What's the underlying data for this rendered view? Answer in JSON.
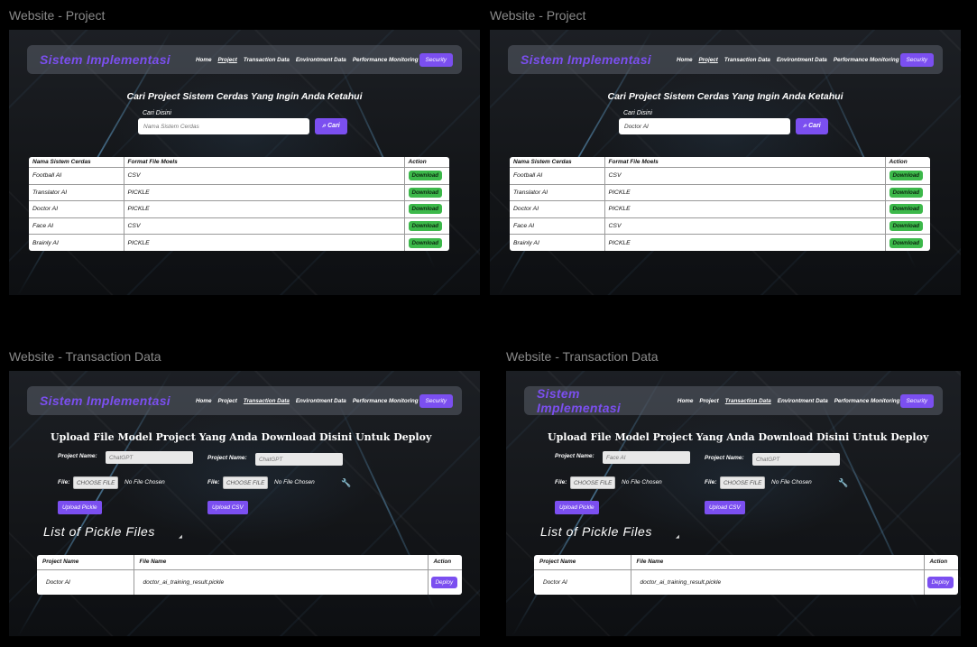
{
  "frame_labels": {
    "project": "Website - Project",
    "transaction": "Website - Transaction Data"
  },
  "navbar": {
    "brand": "Sistem Implementasi",
    "links": [
      "Home",
      "Project",
      "Transaction Data",
      "Environtment Data",
      "Performance Monitoring"
    ],
    "security_button": "Security"
  },
  "project_page": {
    "heading": "Cari Project Sistem Cerdas Yang Ingin Anda Ketahui",
    "search_label": "Cari Disini",
    "search_placeholder": "Nama Sistem Cerdas",
    "search_button": "Cari",
    "columns": [
      "Nama Sistem Cerdas",
      "Format File Moels",
      "Action"
    ],
    "rows": [
      {
        "name": "Football AI",
        "format": "CSV",
        "action": "Download"
      },
      {
        "name": "Translator AI",
        "format": "PICKLE",
        "action": "Download"
      },
      {
        "name": "Doctor AI",
        "format": "PICKLE",
        "action": "Download"
      },
      {
        "name": "Face AI",
        "format": "CSV",
        "action": "Download"
      },
      {
        "name": "Brainly AI",
        "format": "PICKLE",
        "action": "Download"
      }
    ]
  },
  "project_page_2": {
    "search_value": "Doctor AI"
  },
  "transaction_page": {
    "heading": "Upload File Model Project Yang Anda Download Disini Untuk Deploy",
    "project_name_label": "Project Name:",
    "file_label": "File:",
    "choose_file": "CHOOSE FILE",
    "no_file": "No File Chosen",
    "pickle_project_value": "ChatGPT",
    "csv_project_value": "ChatGPT",
    "upload_pickle": "Upload Pickle",
    "upload_csv": "Upload CSV",
    "list_title": "List of Pickle Files",
    "columns": [
      "Project Name",
      "File Name",
      "Action"
    ],
    "rows": [
      {
        "project": "Doctor AI",
        "file": "doctor_ai_training_result.pickle",
        "action": "Deploy"
      }
    ]
  },
  "transaction_page_2": {
    "pickle_project_value": "Face AI",
    "csv_project_value": "ChatGPT"
  }
}
